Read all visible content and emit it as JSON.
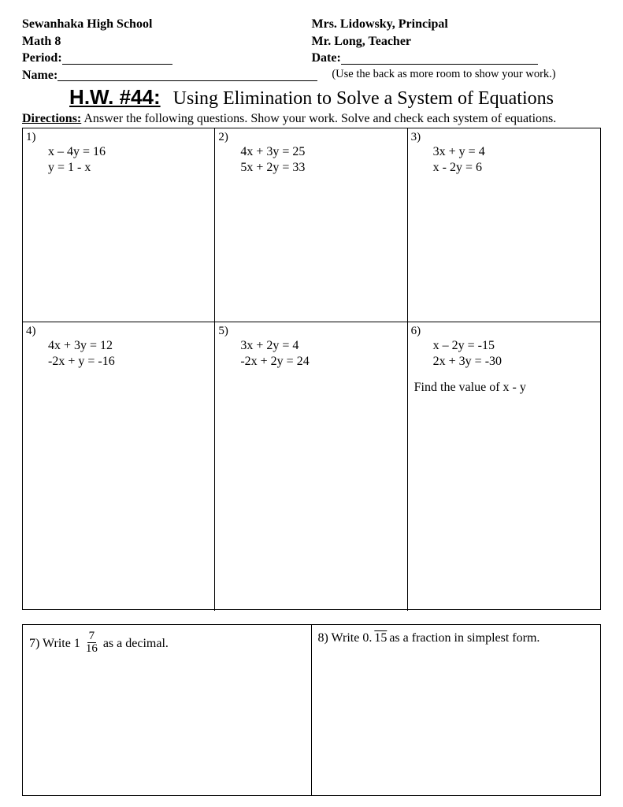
{
  "header": {
    "school": "Sewanhaka High School",
    "principal": "Mrs. Lidowsky, Principal",
    "course": "Math 8",
    "teacher": "Mr. Long, Teacher",
    "period_label": "Period:",
    "date_label": "Date:",
    "name_label": "Name:",
    "note": "(Use the back as more room to show your work.)"
  },
  "title": {
    "hw": "H.W. #44:",
    "subtitle": "Using Elimination to Solve a System of Equations"
  },
  "directions": {
    "label": "Directions:",
    "text": "  Answer the following questions.  Show your work.  Solve and check each system of equations."
  },
  "problems": [
    {
      "num": "1)",
      "line1": "x – 4y = 16",
      "line2": "y = 1 - x",
      "extra": ""
    },
    {
      "num": "2)",
      "line1": "4x + 3y = 25",
      "line2": "5x + 2y = 33",
      "extra": ""
    },
    {
      "num": "3)",
      "line1": "3x + y = 4",
      "line2": "x - 2y = 6",
      "extra": ""
    },
    {
      "num": "4)",
      "line1": "4x + 3y = 12",
      "line2": "-2x + y = -16",
      "extra": ""
    },
    {
      "num": "5)",
      "line1": "3x + 2y = 4",
      "line2": "-2x + 2y = 24",
      "extra": ""
    },
    {
      "num": "6)",
      "line1": "x – 2y = -15",
      "line2": "2x + 3y = -30",
      "extra": "Find the value of x - y"
    }
  ],
  "q7": {
    "num": "7)  Write 1",
    "frac_num": "7",
    "frac_den": "16",
    "after": " as a decimal."
  },
  "q8": {
    "before": "8)  Write 0.",
    "repeating": "15",
    "after": " as a fraction in simplest form."
  }
}
